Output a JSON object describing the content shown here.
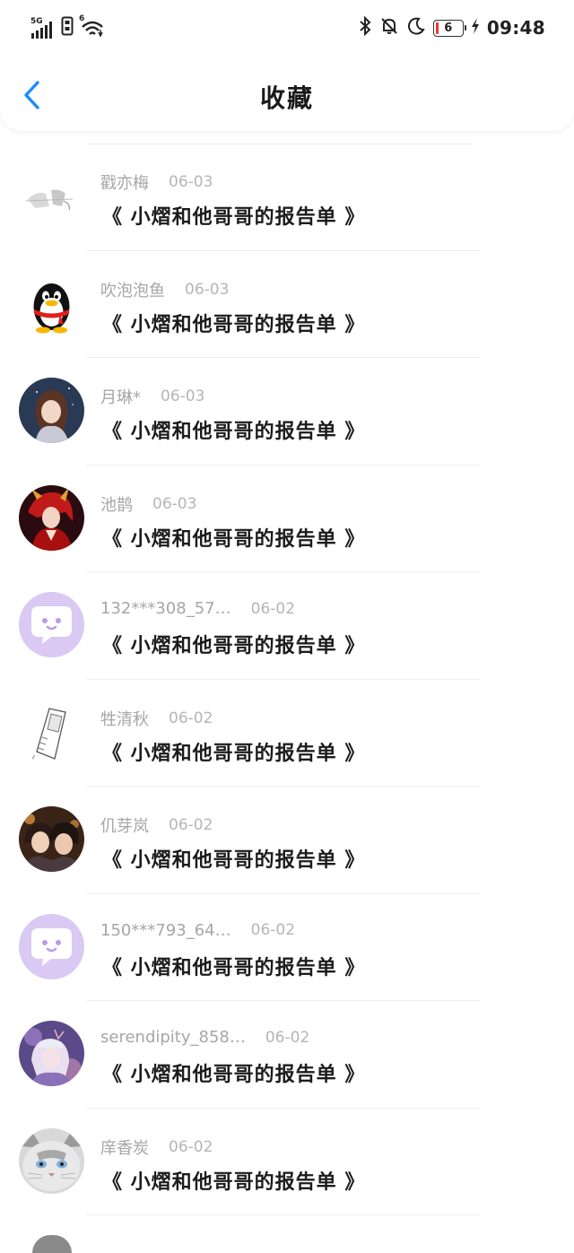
{
  "status_bar": {
    "network": "5G",
    "wifi_badge": "6",
    "battery_level": "6",
    "time": "09:48",
    "icons": [
      "signal-icon",
      "sim-icon",
      "wifi-icon",
      "bluetooth-icon",
      "mute-icon",
      "moon-icon",
      "battery-icon",
      "charging-icon"
    ]
  },
  "nav": {
    "title": "收藏",
    "back_icon": "chevron-left-icon"
  },
  "colors": {
    "accent": "#1a8cff",
    "name_text": "#a6a6a6",
    "title_text": "#1c1c1c",
    "divider": "#eeeeee"
  },
  "items": [
    {
      "name": "戳亦梅",
      "date": "06-03",
      "title": "《 小熠和他哥哥的报告单 》",
      "avatar": "sketch-avatar"
    },
    {
      "name": "吹泡泡鱼",
      "date": "06-03",
      "title": "《 小熠和他哥哥的报告单 》",
      "avatar": "qq-penguin-avatar"
    },
    {
      "name": "月琳*",
      "date": "06-03",
      "title": "《 小熠和他哥哥的报告单 》",
      "avatar": "anime-girl-avatar"
    },
    {
      "name": "池鹊",
      "date": "06-03",
      "title": "《 小熠和他哥哥的报告单 》",
      "avatar": "red-anime-avatar"
    },
    {
      "name": "132***308_57…",
      "date": "06-02",
      "title": "《 小熠和他哥哥的报告单 》",
      "avatar": "default-chat-avatar"
    },
    {
      "name": "牲清秋",
      "date": "06-02",
      "title": "《 小熠和他哥哥的报告单 》",
      "avatar": "sketch-phone-avatar"
    },
    {
      "name": "仉芽岚",
      "date": "06-02",
      "title": "《 小熠和他哥哥的报告单 》",
      "avatar": "couple-anime-avatar"
    },
    {
      "name": "150***793_64…",
      "date": "06-02",
      "title": "《 小熠和他哥哥的报告单 》",
      "avatar": "default-chat-avatar"
    },
    {
      "name": "serendipity_858…",
      "date": "06-02",
      "title": "《 小熠和他哥哥的报告单 》",
      "avatar": "purple-anime-avatar"
    },
    {
      "name": "庠香炭",
      "date": "06-02",
      "title": "《 小熠和他哥哥的报告单 》",
      "avatar": "cat-avatar"
    }
  ]
}
